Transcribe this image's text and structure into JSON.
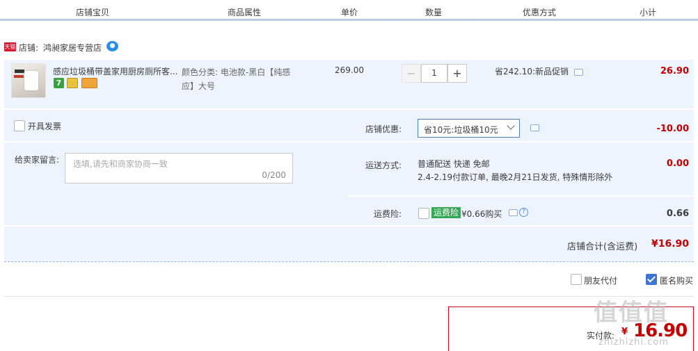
{
  "header": {
    "col_shop_item": "店铺宝贝",
    "col_attributes": "商品属性",
    "col_unit_price": "单价",
    "col_quantity": "数量",
    "col_discount": "优惠方式",
    "col_subtotal": "小计"
  },
  "shop": {
    "badge_text": "天猫",
    "label": "店铺:",
    "name": "鸿昶家居专营店"
  },
  "item": {
    "title": "感应垃圾桶带盖家用厨房厕所客...",
    "attributes": "颜色分类: 电池款-黑白【纯感应】大号",
    "badge_7": "7",
    "unit_price": "269.00",
    "quantity": "1",
    "minus": "−",
    "plus": "+",
    "promo": "省242.10:新品促销",
    "subtotal": "26.90"
  },
  "options": {
    "invoice_label": "开具发票",
    "message_label": "给卖家留言:",
    "message_placeholder": "选填,请先和商家协商一致",
    "message_counter": "0/200",
    "store_discount_label": "店铺优惠:",
    "store_discount_selected": "省10元:垃圾桶10元",
    "store_discount_value": "-10.00",
    "shipping_label": "运送方式:",
    "shipping_method": "普通配送 快递 免邮",
    "shipping_note": "2.4-2.19付款订单, 最晚2月21日发货, 特殊情形除外",
    "shipping_value": "0.00",
    "insurance_label": "运费险:",
    "insurance_tag": "运费险",
    "insurance_price": "¥0.66购买",
    "insurance_value": "0.66",
    "help_icon": "?"
  },
  "store_total": {
    "label": "店铺合计(含运费)",
    "value": "¥16.90"
  },
  "bottom": {
    "friend_pay_label": "朋友代付",
    "anonymous_label": "匿名购买"
  },
  "pay": {
    "label": "实付款:",
    "currency": "¥",
    "value": "16.90"
  },
  "watermark": {
    "big": "值值值",
    "small": "zhizhizhi.com"
  },
  "colors": {
    "accent_red": "#c40000",
    "row_bg": "#eef4fd",
    "header_border": "#b9cde8",
    "checkbox_blue": "#3b75d4",
    "insurance_green": "#34a853"
  }
}
